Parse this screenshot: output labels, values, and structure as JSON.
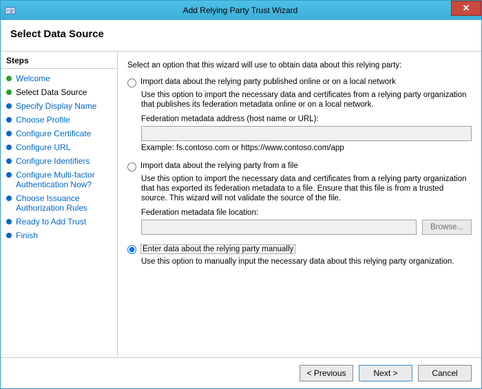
{
  "window": {
    "title": "Add Relying Party Trust Wizard"
  },
  "header": {
    "title": "Select Data Source"
  },
  "sidebar": {
    "title": "Steps",
    "items": [
      {
        "label": "Welcome",
        "state": "completed"
      },
      {
        "label": "Select Data Source",
        "state": "current"
      },
      {
        "label": "Specify Display Name",
        "state": "pending"
      },
      {
        "label": "Choose Profile",
        "state": "pending"
      },
      {
        "label": "Configure Certificate",
        "state": "pending"
      },
      {
        "label": "Configure URL",
        "state": "pending"
      },
      {
        "label": "Configure Identifiers",
        "state": "pending"
      },
      {
        "label": "Configure Multi-factor Authentication Now?",
        "state": "pending"
      },
      {
        "label": "Choose Issuance Authorization Rules",
        "state": "pending"
      },
      {
        "label": "Ready to Add Trust",
        "state": "pending"
      },
      {
        "label": "Finish",
        "state": "pending"
      }
    ]
  },
  "content": {
    "intro": "Select an option that this wizard will use to obtain data about this relying party:",
    "opt1": {
      "label": "Import data about the relying party published online or on a local network",
      "desc": "Use this option to import the necessary data and certificates from a relying party organization that publishes its federation metadata online or on a local network.",
      "field_label": "Federation metadata address (host name or URL):",
      "field_value": "",
      "example": "Example: fs.contoso.com or https://www.contoso.com/app"
    },
    "opt2": {
      "label": "Import data about the relying party from a file",
      "desc": "Use this option to import the necessary data and certificates from a relying party organization that has exported its federation metadata to a file. Ensure that this file is from a trusted source.  This wizard will not validate the source of the file.",
      "field_label": "Federation metadata file location:",
      "field_value": "",
      "browse": "Browse..."
    },
    "opt3": {
      "label": "Enter data about the relying party manually",
      "desc": "Use this option to manually input the necessary data about this relying party organization."
    },
    "selected": "opt3"
  },
  "footer": {
    "previous": "< Previous",
    "next": "Next >",
    "cancel": "Cancel"
  }
}
